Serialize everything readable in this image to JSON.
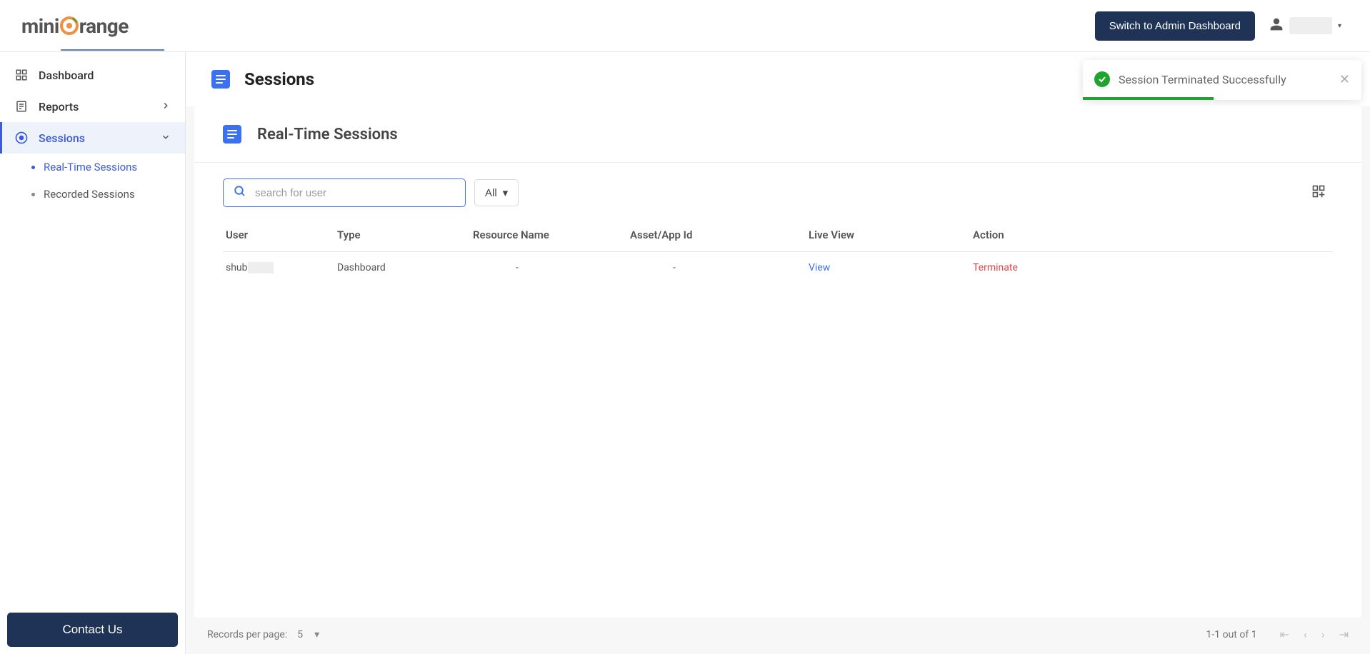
{
  "header": {
    "brand_prefix": "mini",
    "brand_suffix": "range",
    "switch_label": "Switch to Admin Dashboard"
  },
  "sidebar": {
    "items": [
      {
        "label": "Dashboard"
      },
      {
        "label": "Reports"
      },
      {
        "label": "Sessions"
      }
    ],
    "sub": [
      {
        "label": "Real-Time Sessions"
      },
      {
        "label": "Recorded Sessions"
      }
    ],
    "contact_label": "Contact Us"
  },
  "page": {
    "title": "Sessions",
    "panel_title": "Real-Time Sessions"
  },
  "toolbar": {
    "search_placeholder": "search for user",
    "filter_label": "All"
  },
  "table": {
    "columns": {
      "user": "User",
      "type": "Type",
      "resource": "Resource Name",
      "asset": "Asset/App Id",
      "live": "Live View",
      "action": "Action"
    },
    "rows": [
      {
        "user_prefix": "shub",
        "type": "Dashboard",
        "resource": "-",
        "asset": "-",
        "live": "View",
        "action": "Terminate"
      }
    ]
  },
  "footer": {
    "per_page_label": "Records per page:",
    "per_page_value": "5",
    "range_text": "1-1 out of 1"
  },
  "toast": {
    "message": "Session Terminated Successfully"
  }
}
